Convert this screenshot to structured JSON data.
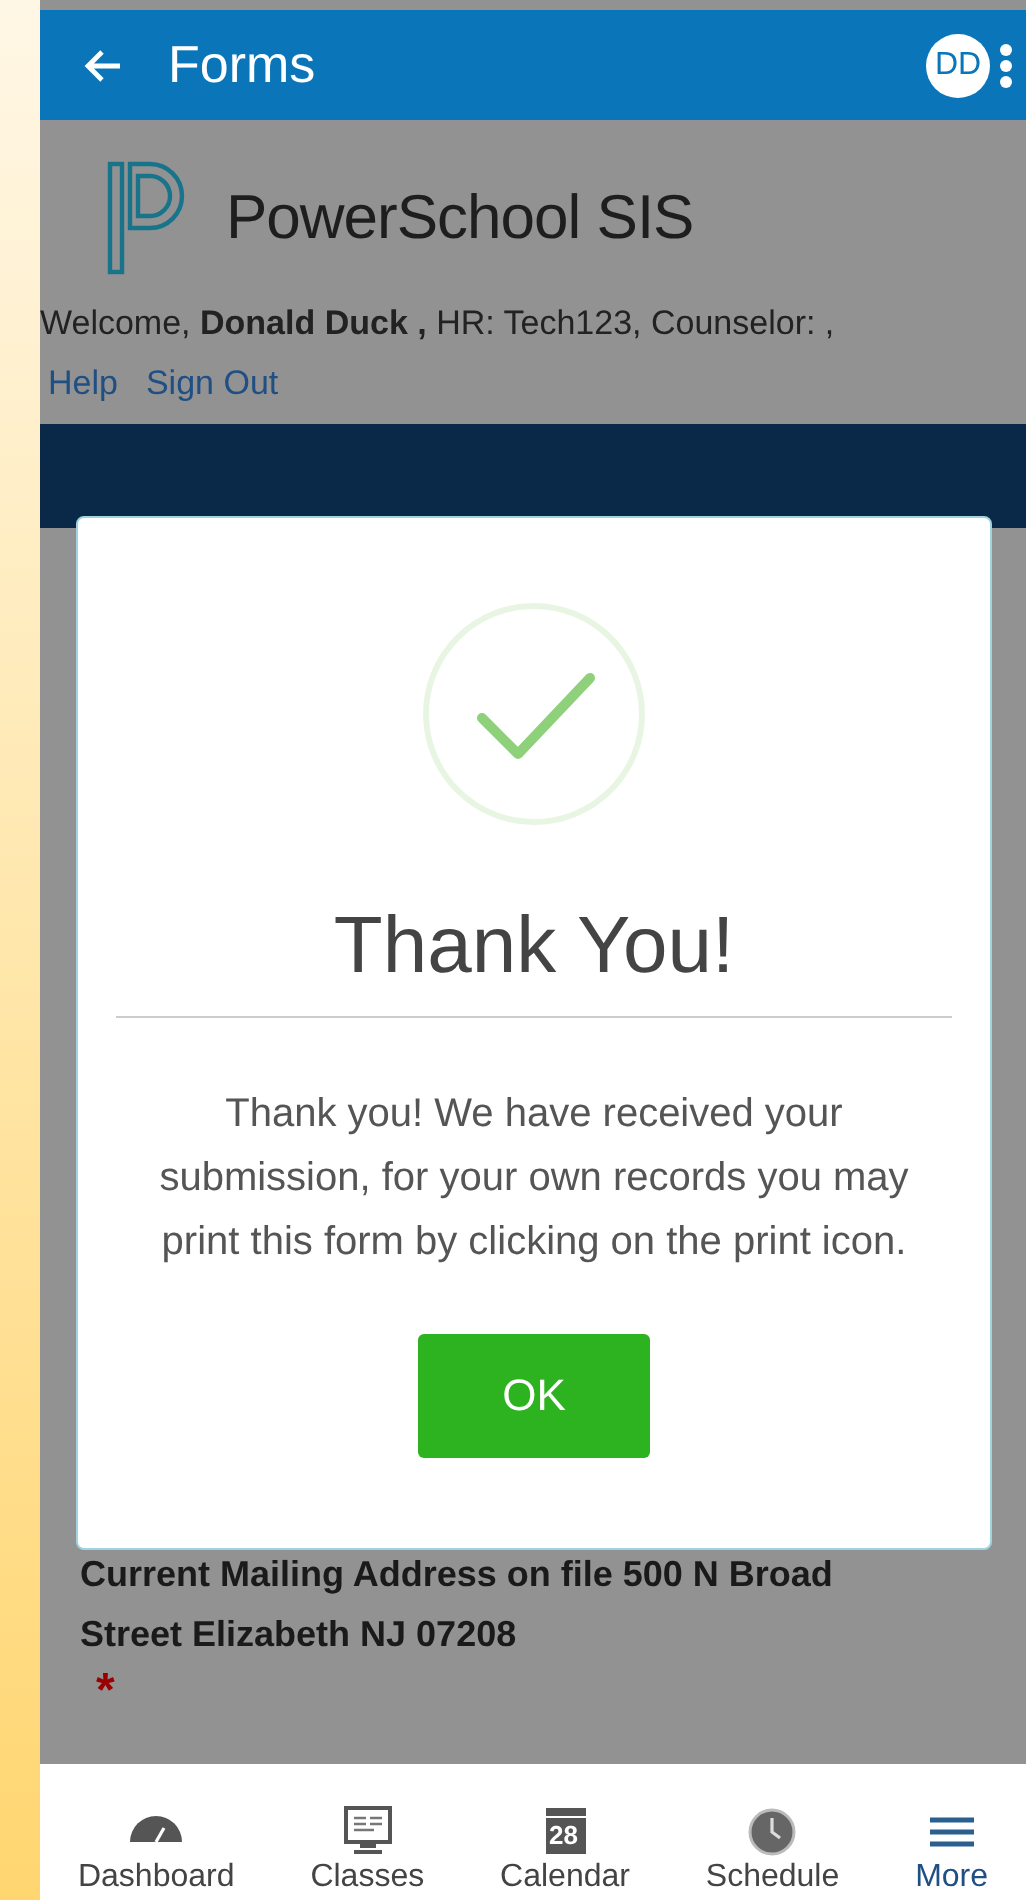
{
  "app_bar": {
    "title": "Forms",
    "avatar": "DD"
  },
  "page": {
    "logo_text": "PowerSchool SIS",
    "welcome": "Welcome, **Donald Duck ,** HR: Tech123, Counselor:  ,",
    "links": [
      "Help",
      "Sign Out"
    ],
    "question": "Current Mailing Address on file 500 N Broad Street Elizabeth NJ 07208",
    "required_mark": "*"
  },
  "dialog": {
    "title": "Thank You!",
    "message": "Thank you! We have received your submission, for your own records you may print this form by clicking on the print icon.",
    "button": "OK"
  },
  "bottom_nav": [
    {
      "kind": "dashboard",
      "label": "Dashboard",
      "selected": false
    },
    {
      "kind": "classes",
      "label": "Classes",
      "selected": false
    },
    {
      "kind": "calendar",
      "label": "Calendar",
      "selected": false,
      "badge": "28"
    },
    {
      "kind": "schedule",
      "label": "Schedule",
      "selected": false
    },
    {
      "kind": "more",
      "label": "More",
      "selected": true
    }
  ]
}
